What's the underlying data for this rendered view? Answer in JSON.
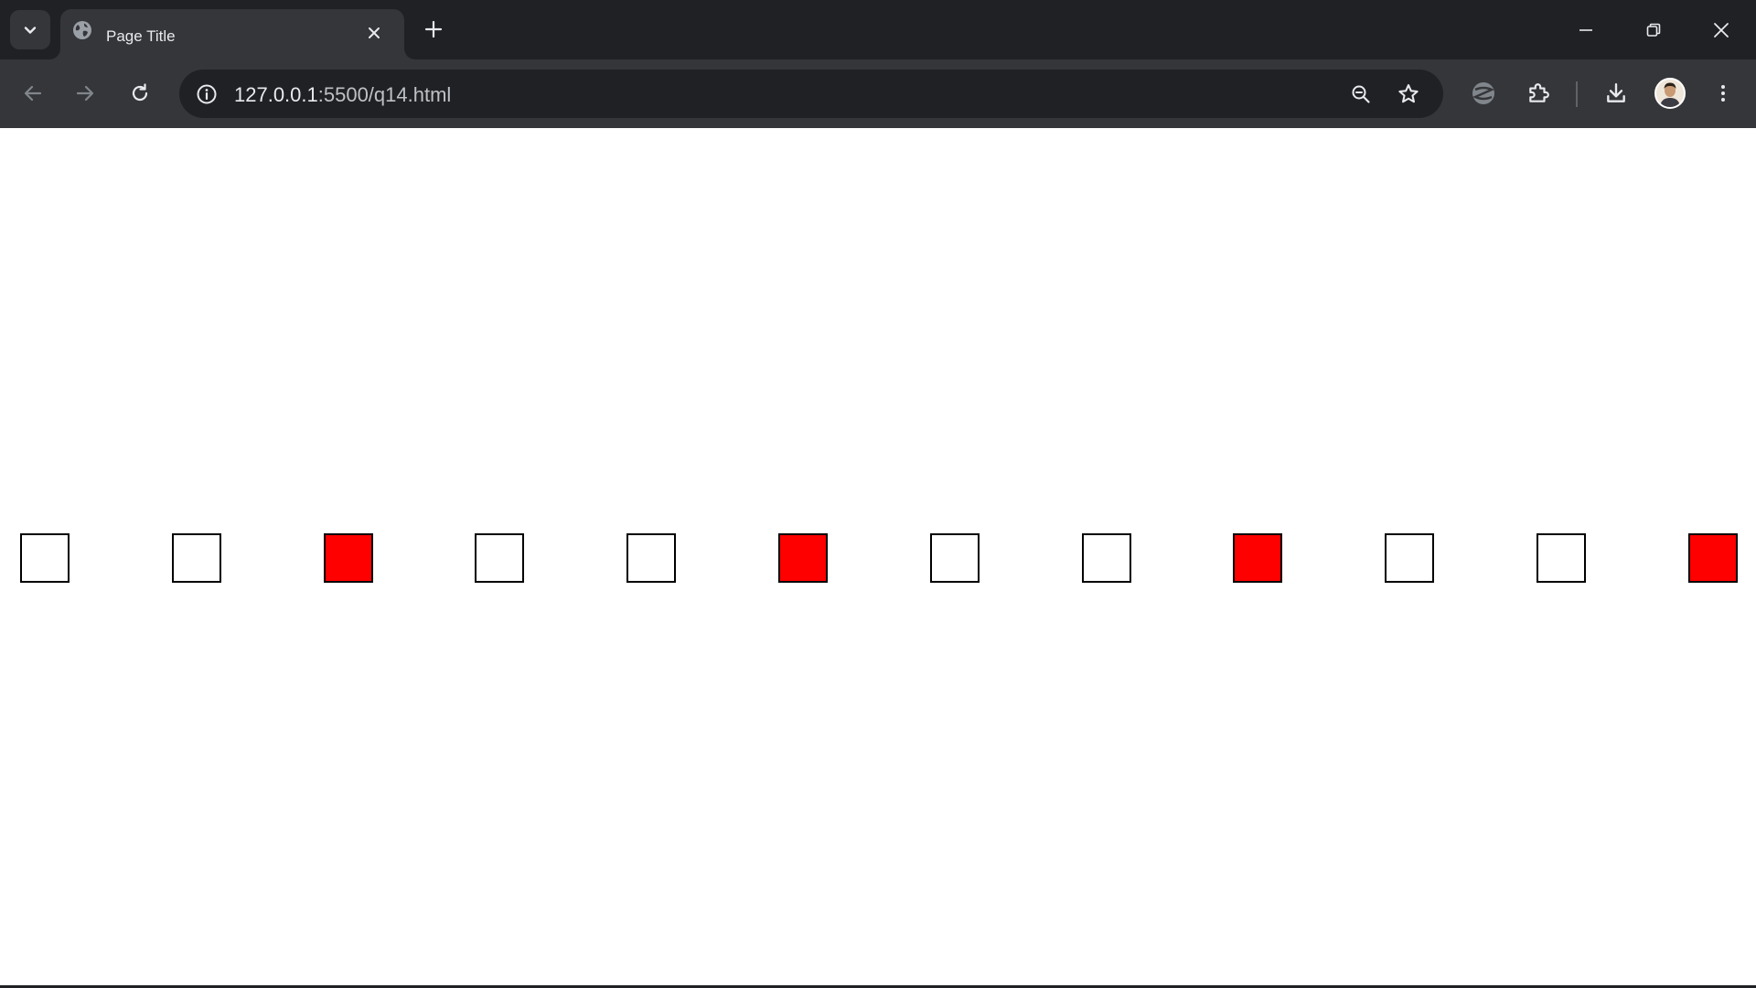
{
  "browser": {
    "tab": {
      "title": "Page Title",
      "favicon": "globe-icon"
    },
    "address_bar": {
      "url_host": "127.0.0.1",
      "url_rest": ":5500/q14.html"
    },
    "colors": {
      "frame": "#202124",
      "toolbar": "#35363a",
      "text": "#e8eaed"
    }
  },
  "page": {
    "squares": [
      {
        "fill": "white"
      },
      {
        "fill": "white"
      },
      {
        "fill": "red"
      },
      {
        "fill": "white"
      },
      {
        "fill": "white"
      },
      {
        "fill": "red"
      },
      {
        "fill": "white"
      },
      {
        "fill": "white"
      },
      {
        "fill": "red"
      },
      {
        "fill": "white"
      },
      {
        "fill": "white"
      },
      {
        "fill": "red"
      }
    ],
    "colors": {
      "red": "#ff0000",
      "white": "#ffffff",
      "border": "#000000"
    }
  }
}
